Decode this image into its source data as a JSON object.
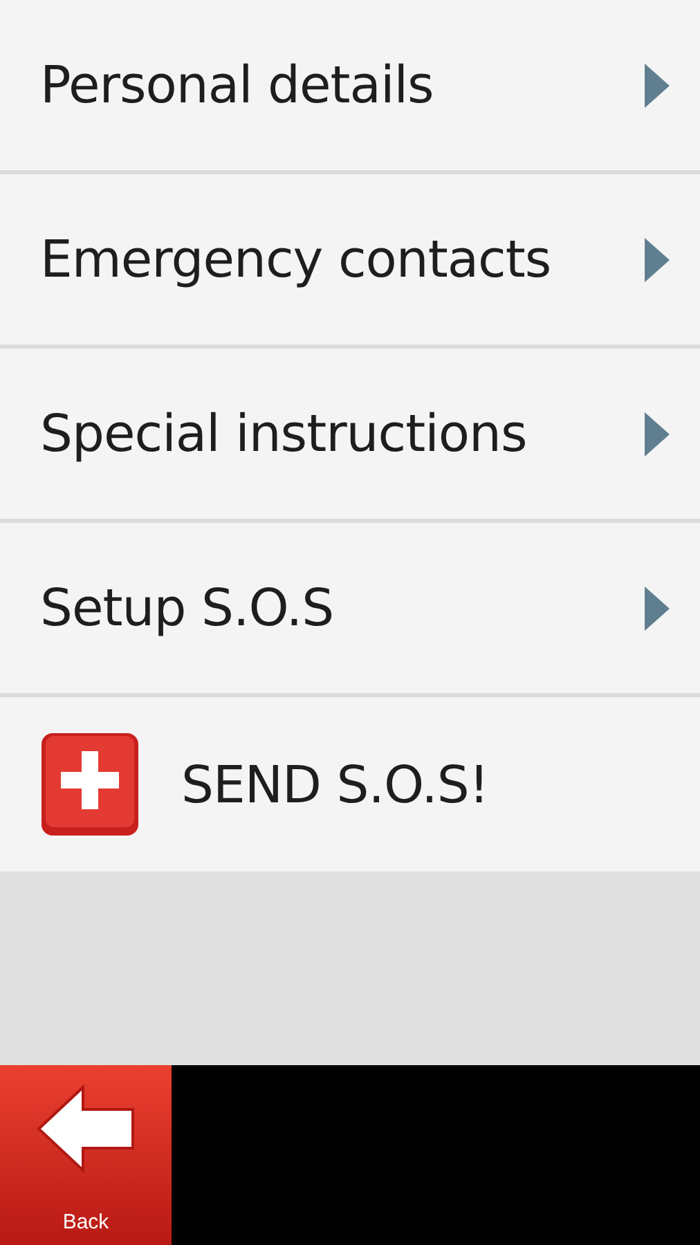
{
  "menu": [
    {
      "kind": "link",
      "label": "Personal details"
    },
    {
      "kind": "link",
      "label": "Emergency contacts"
    },
    {
      "kind": "link",
      "label": "Special instructions"
    },
    {
      "kind": "link",
      "label": "Setup S.O.S"
    },
    {
      "kind": "action",
      "label": "SEND S.O.S!"
    }
  ],
  "bottom_bar": {
    "back_label": "Back"
  }
}
